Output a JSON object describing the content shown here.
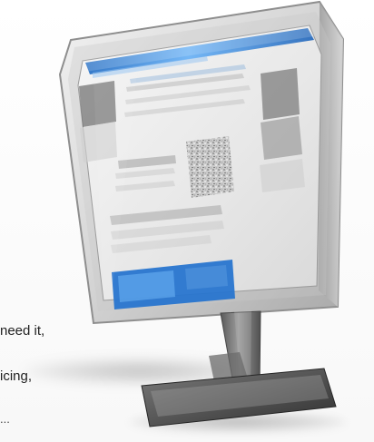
{
  "caption_lines": [
    "need it,",
    "icing,",
    "..."
  ],
  "colors": {
    "bezel": "#d7d7d7",
    "bezel_dark": "#8f8f8f",
    "screen_bg": "#f1f1f1",
    "screen_blue": "#2f7fd6",
    "screen_blue_light": "#7fb7ef",
    "screen_gray": "#b8b8b8",
    "stand": "#7d7d7d"
  }
}
